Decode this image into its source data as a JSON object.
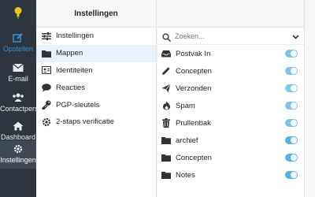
{
  "colors": {
    "nav_bg": "#2d3640",
    "active_nav": "#3d4a56",
    "accent": "#3c8fd6",
    "toggle_on": "#78c6ee",
    "toggle_on_strong": "#4fb3ea",
    "logo": "#f2c31b"
  },
  "nav": {
    "items": [
      {
        "label": "Opstellen",
        "icon": "compose-icon"
      },
      {
        "label": "E-mail",
        "icon": "envelope-icon"
      },
      {
        "label": "Contactpersonen",
        "icon": "users-icon"
      },
      {
        "label": "Dashboard",
        "icon": "home-icon"
      },
      {
        "label": "Instellingen",
        "icon": "gear-icon"
      }
    ]
  },
  "settings": {
    "header": "Instellingen",
    "items": [
      {
        "label": "Instellingen",
        "icon": "sliders-icon"
      },
      {
        "label": "Mappen",
        "icon": "folder-icon"
      },
      {
        "label": "Identiteiten",
        "icon": "id-card-icon"
      },
      {
        "label": "Reacties",
        "icon": "speech-bubble-icon"
      },
      {
        "label": "PGP-sleutels",
        "icon": "key-icon"
      },
      {
        "label": "2-staps verificatie",
        "icon": "gear-icon"
      }
    ]
  },
  "folders": {
    "search_placeholder": "Zoeken...",
    "items": [
      {
        "label": "Postvak In",
        "icon": "inbox-icon",
        "subscribed": true
      },
      {
        "label": "Concepten",
        "icon": "pencil-icon",
        "subscribed": true
      },
      {
        "label": "Verzonden",
        "icon": "paper-plane-icon",
        "subscribed": true
      },
      {
        "label": "Spam",
        "icon": "fire-icon",
        "subscribed": true
      },
      {
        "label": "Prullenbak",
        "icon": "trash-icon",
        "subscribed": true
      },
      {
        "label": "archief",
        "icon": "folder-icon",
        "subscribed": true
      },
      {
        "label": "Concepten",
        "icon": "folder-icon",
        "subscribed": true
      },
      {
        "label": "Notes",
        "icon": "folder-icon",
        "subscribed": true
      }
    ]
  }
}
